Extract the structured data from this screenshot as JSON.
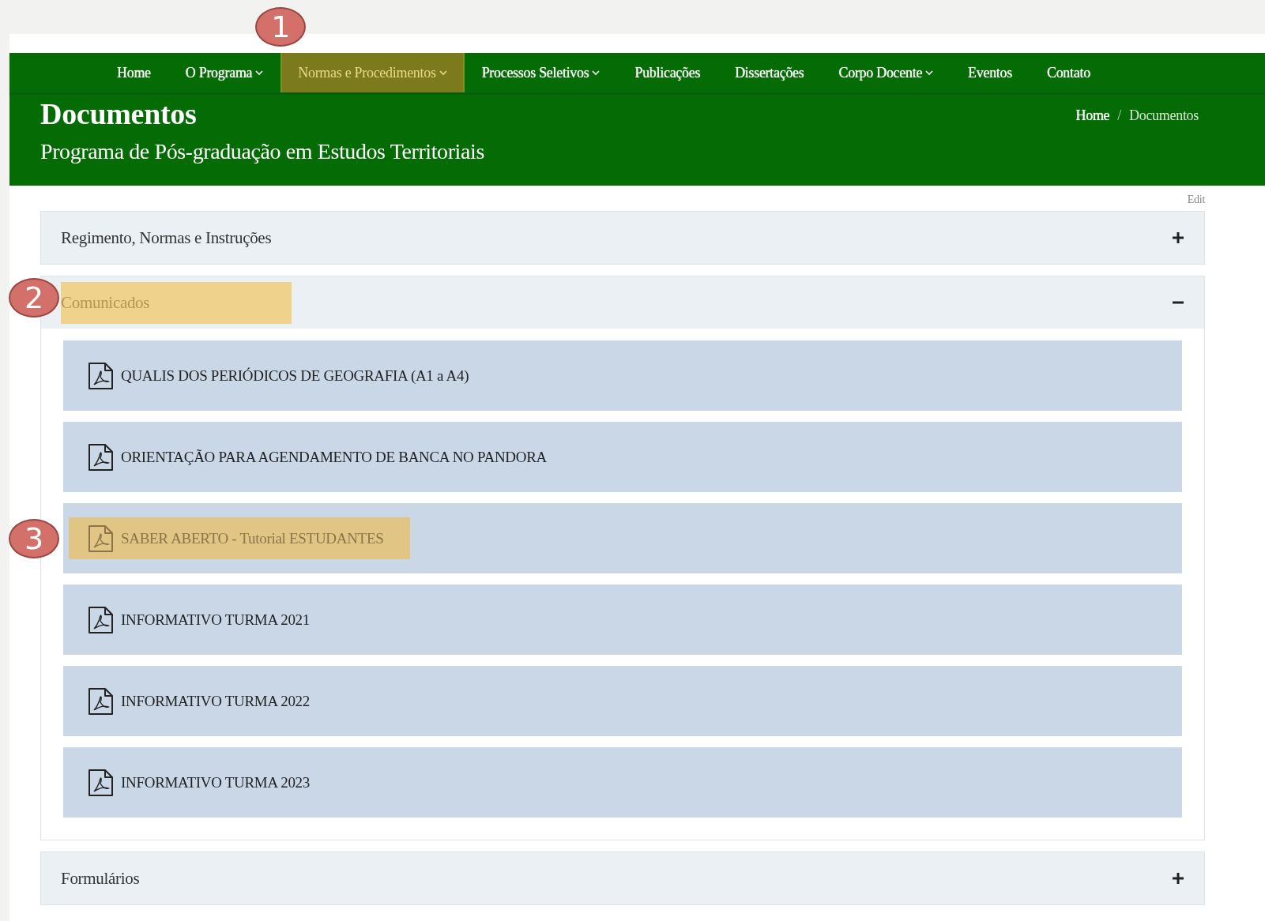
{
  "nav": {
    "items": [
      {
        "label": "Home",
        "dropdown": false,
        "highlighted": false
      },
      {
        "label": "O Programa",
        "dropdown": true,
        "highlighted": false
      },
      {
        "label": "Normas e Procedimentos",
        "dropdown": true,
        "highlighted": true,
        "marker": "1"
      },
      {
        "label": "Processos Seletivos",
        "dropdown": true,
        "highlighted": false
      },
      {
        "label": "Publicações",
        "dropdown": false,
        "highlighted": false
      },
      {
        "label": "Dissertações",
        "dropdown": false,
        "highlighted": false
      },
      {
        "label": "Corpo Docente",
        "dropdown": true,
        "highlighted": false
      },
      {
        "label": "Eventos",
        "dropdown": false,
        "highlighted": false
      },
      {
        "label": "Contato",
        "dropdown": false,
        "highlighted": false
      }
    ]
  },
  "header": {
    "title": "Documentos",
    "subtitle": "Programa de Pós-graduação em Estudos Territoriais",
    "breadcrumb_separator": "/",
    "breadcrumb": [
      {
        "label": "Home"
      },
      {
        "label": "Documentos"
      }
    ]
  },
  "edit_link": "Edit",
  "accordion": [
    {
      "title": "Regimento, Normas e Instruções",
      "expanded": false,
      "highlighted": false
    },
    {
      "title": "Comunicados",
      "expanded": true,
      "highlighted": true,
      "marker": "2",
      "items": [
        {
          "label": "QUALIS DOS PERIÓDICOS DE GEOGRAFIA (A1 a A4)",
          "highlighted": false
        },
        {
          "label": "ORIENTAÇÃO PARA AGENDAMENTO DE BANCA NO PANDORA",
          "highlighted": false
        },
        {
          "label": "SABER ABERTO - Tutorial ESTUDANTES",
          "highlighted": true,
          "marker": "3"
        },
        {
          "label": "INFORMATIVO TURMA 2021",
          "highlighted": false
        },
        {
          "label": "INFORMATIVO TURMA 2022",
          "highlighted": false
        },
        {
          "label": "INFORMATIVO TURMA 2023",
          "highlighted": false
        }
      ]
    },
    {
      "title": "Formulários",
      "expanded": false,
      "highlighted": false
    }
  ]
}
